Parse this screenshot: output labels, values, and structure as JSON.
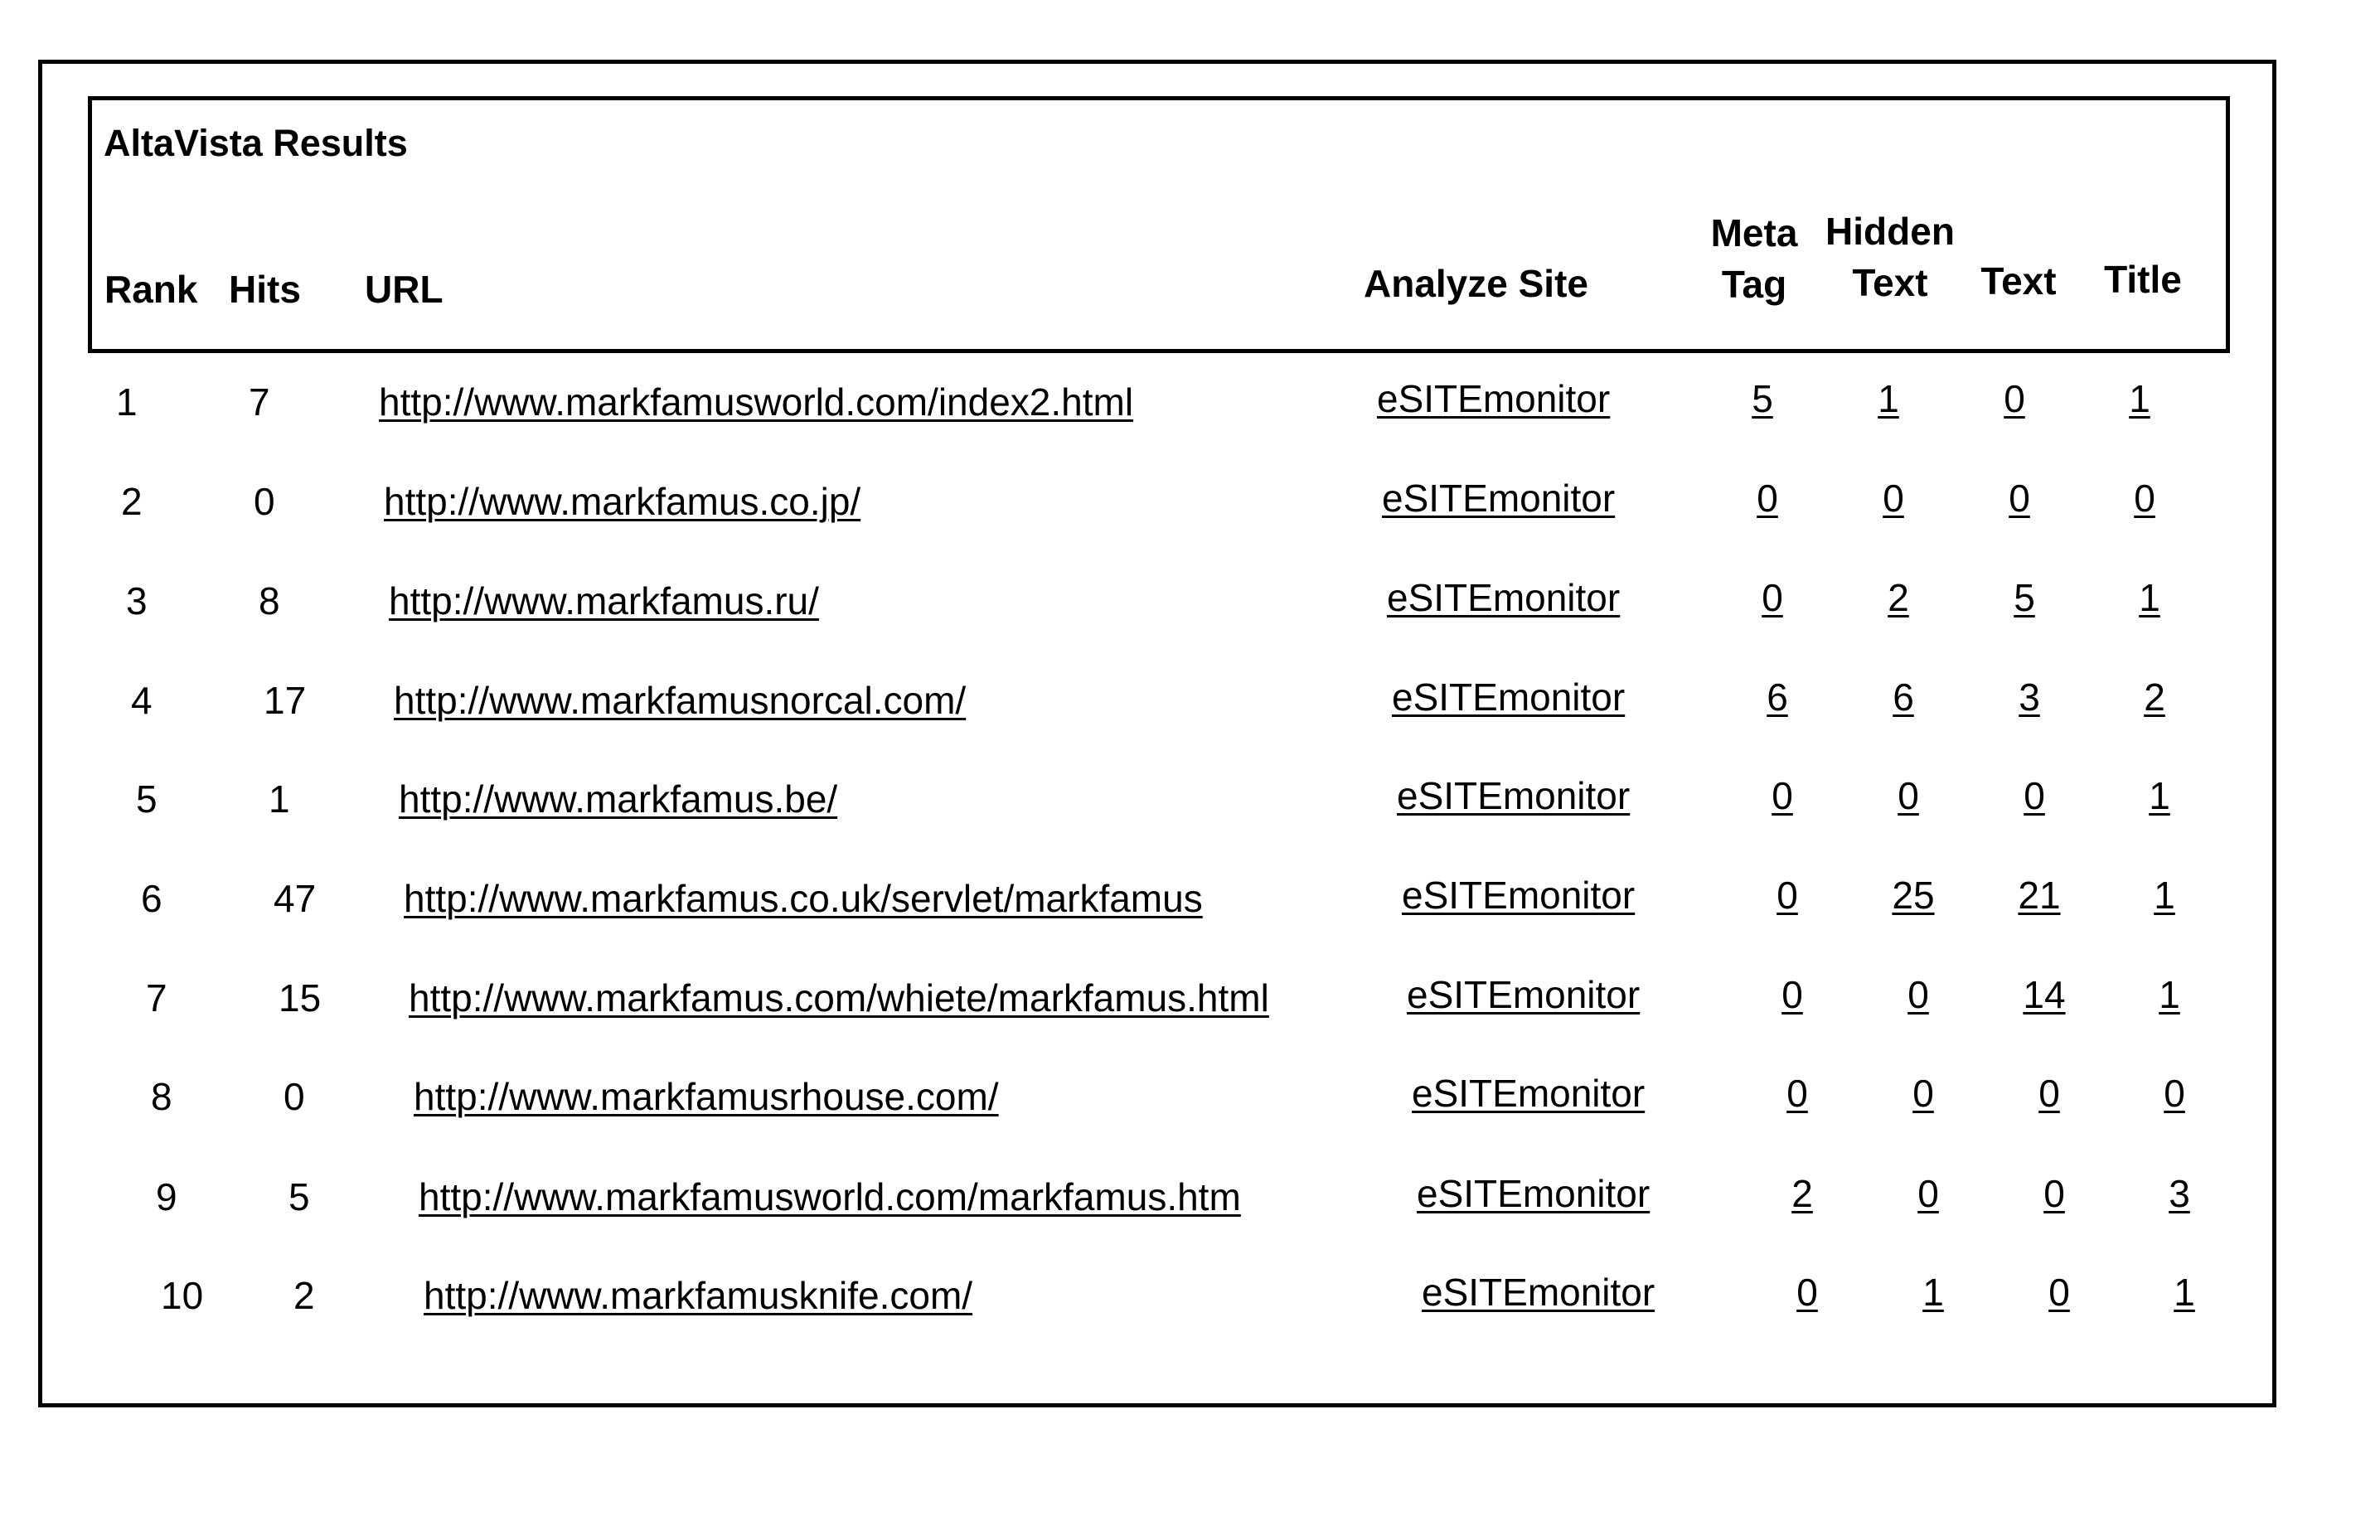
{
  "panel": {
    "title": "AltaVista Results"
  },
  "headers": {
    "rank": "Rank",
    "hits": "Hits",
    "url": "URL",
    "analyze_site": "Analyze Site",
    "meta_tag": [
      "Meta",
      "Tag"
    ],
    "hidden_text": [
      "Hidden",
      "Text"
    ],
    "text": "Text",
    "title": "Title"
  },
  "rows": [
    {
      "rank": "1",
      "hits": "7",
      "url": "http://www.markfamusworld.com/index2.html",
      "analyze": "eSITEmonitor",
      "meta_tag": "5",
      "hidden_text": "1",
      "text": "0",
      "title": "1"
    },
    {
      "rank": "2",
      "hits": "0",
      "url": "http://www.markfamus.co.jp/",
      "analyze": "eSITEmonitor",
      "meta_tag": "0",
      "hidden_text": "0",
      "text": "0",
      "title": "0"
    },
    {
      "rank": "3",
      "hits": "8",
      "url": "http://www.markfamus.ru/",
      "analyze": "eSITEmonitor",
      "meta_tag": "0",
      "hidden_text": "2",
      "text": "5",
      "title": "1"
    },
    {
      "rank": "4",
      "hits": "17",
      "url": "http://www.markfamusnorcal.com/",
      "analyze": "eSITEmonitor",
      "meta_tag": "6",
      "hidden_text": "6",
      "text": "3",
      "title": "2"
    },
    {
      "rank": "5",
      "hits": "1",
      "url": "http://www.markfamus.be/",
      "analyze": "eSITEmonitor",
      "meta_tag": "0",
      "hidden_text": "0",
      "text": "0",
      "title": "1"
    },
    {
      "rank": "6",
      "hits": "47",
      "url": "http://www.markfamus.co.uk/servlet/markfamus",
      "analyze": "eSITEmonitor",
      "meta_tag": "0",
      "hidden_text": "25",
      "text": "21",
      "title": "1"
    },
    {
      "rank": "7",
      "hits": "15",
      "url": "http://www.markfamus.com/whiete/markfamus.html",
      "analyze": "eSITEmonitor",
      "meta_tag": "0",
      "hidden_text": "0",
      "text": "14",
      "title": "1"
    },
    {
      "rank": "8",
      "hits": "0",
      "url": "http://www.markfamusrhouse.com/",
      "analyze": "eSITEmonitor",
      "meta_tag": "0",
      "hidden_text": "0",
      "text": "0",
      "title": "0"
    },
    {
      "rank": "9",
      "hits": "5",
      "url": "http://www.markfamusworld.com/markfamus.htm",
      "analyze": "eSITEmonitor",
      "meta_tag": "2",
      "hidden_text": "0",
      "text": "0",
      "title": "3"
    },
    {
      "rank": "10",
      "hits": "2",
      "url": "http://www.markfamusknife.com/",
      "analyze": "eSITEmonitor",
      "meta_tag": "0",
      "hidden_text": "1",
      "text": "0",
      "title": "1"
    }
  ]
}
